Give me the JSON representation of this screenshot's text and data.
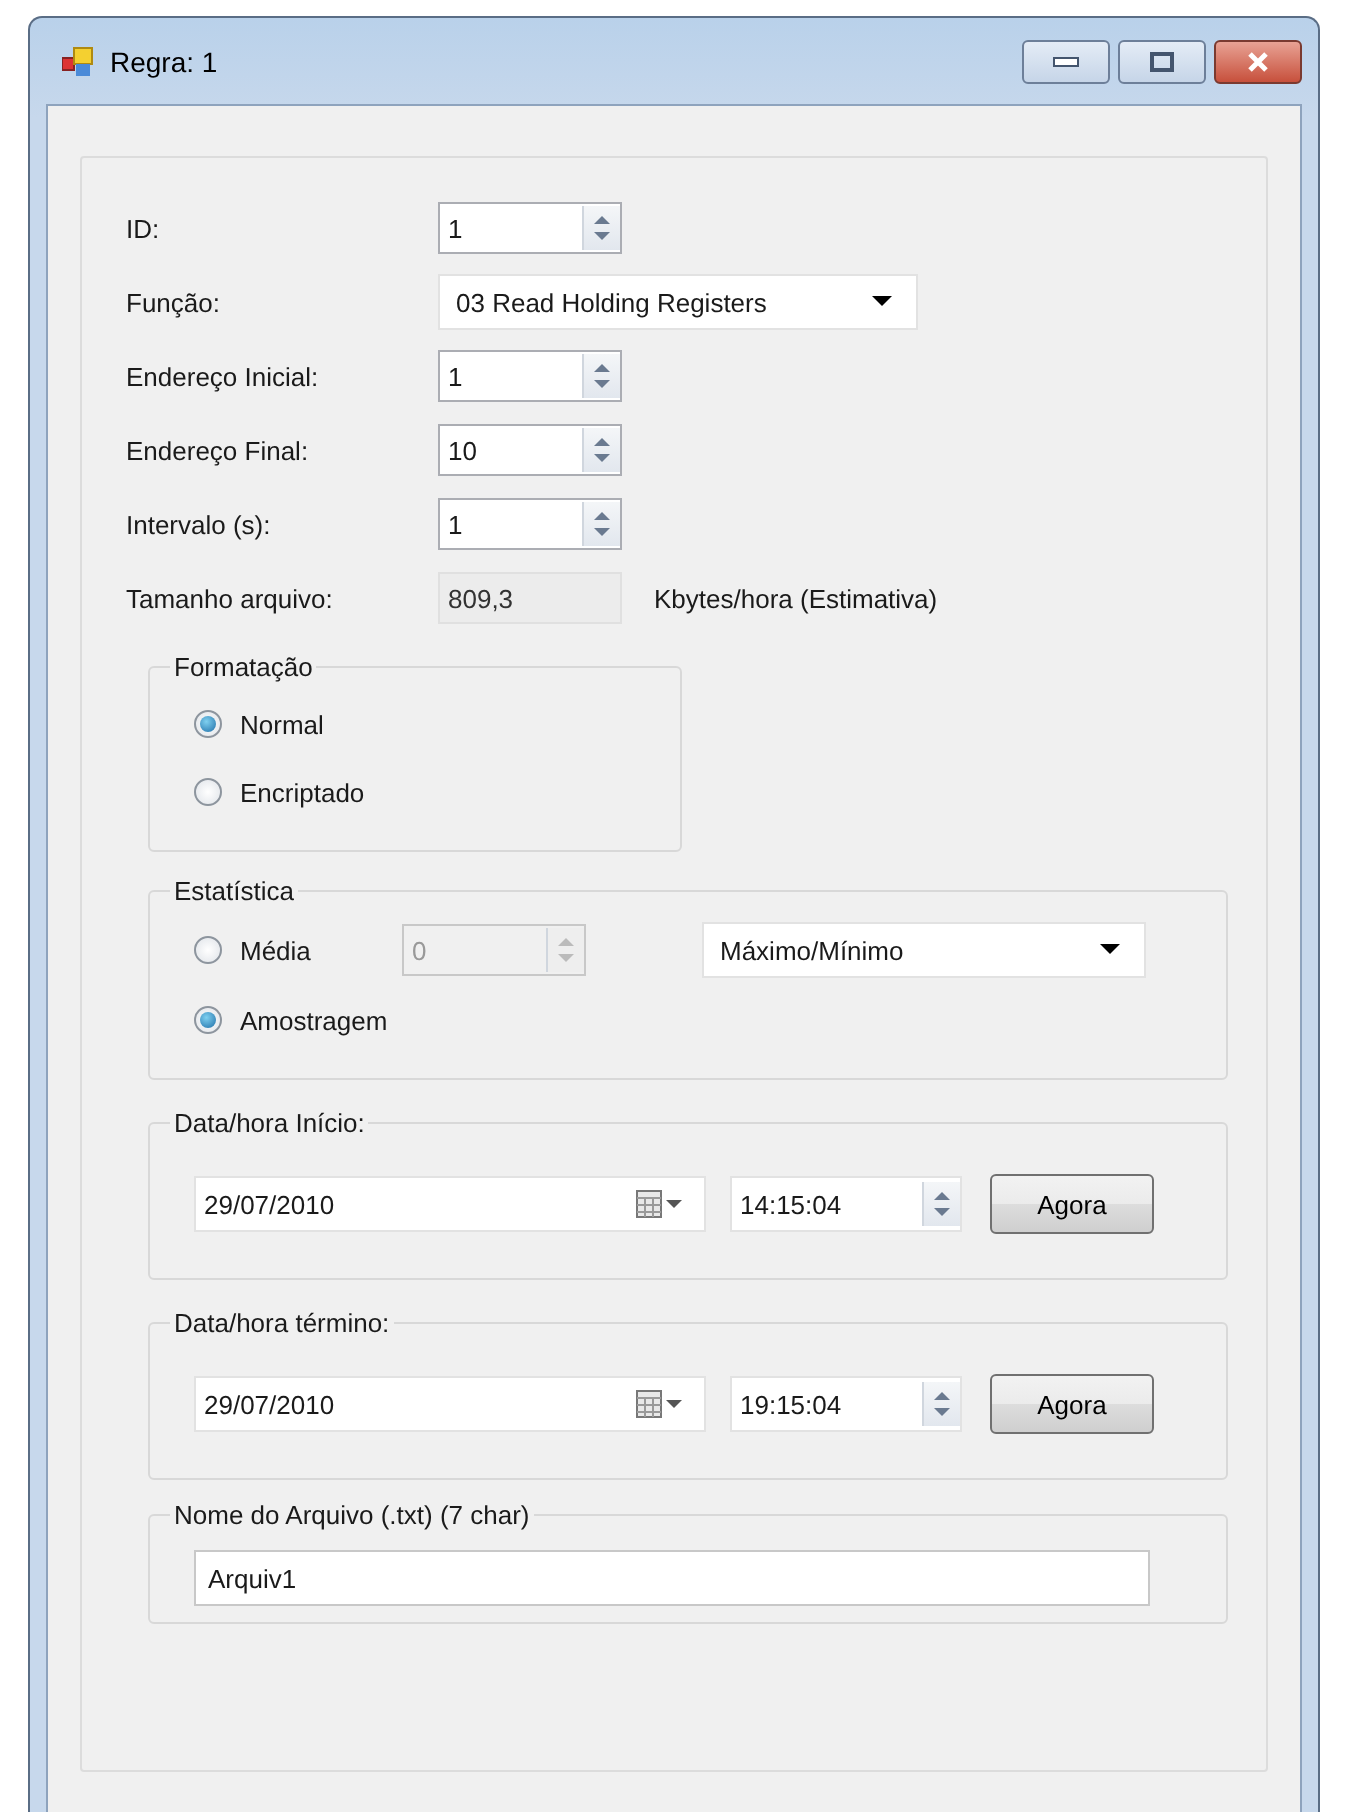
{
  "window": {
    "title": "Regra: 1"
  },
  "fields": [
    {
      "label": "ID:",
      "kind": "spinner",
      "value": "1"
    },
    {
      "label": "Função:",
      "kind": "dropdown",
      "value": "03 Read Holding Registers"
    },
    {
      "label": "Endereço Inicial:",
      "kind": "spinner",
      "value": "1"
    },
    {
      "label": "Endereço Final:",
      "kind": "spinner",
      "value": "10"
    },
    {
      "label": "Intervalo (s):",
      "kind": "spinner",
      "value": "1"
    },
    {
      "label": "Tamanho arquivo:",
      "kind": "readonly",
      "value": "809,3",
      "unit": "Kbytes/hora (Estimativa)"
    }
  ],
  "formatacao": {
    "title": "Formatação",
    "options": [
      {
        "label": "Normal",
        "selected": true
      },
      {
        "label": "Encriptado",
        "selected": false
      }
    ]
  },
  "estatistica": {
    "title": "Estatística",
    "options": [
      {
        "label": "Média",
        "selected": false
      },
      {
        "label": "Amostragem",
        "selected": true
      }
    ],
    "media_spinner": {
      "value": "0",
      "disabled": true
    },
    "mode": {
      "value": "Máximo/Mínimo"
    }
  },
  "periods": [
    {
      "title": "Data/hora Início:",
      "date": "29/07/2010",
      "time": "14:15:04",
      "button": "Agora"
    },
    {
      "title": "Data/hora término:",
      "date": "29/07/2010",
      "time": "19:15:04",
      "button": "Agora"
    }
  ],
  "arquivo": {
    "title": "Nome do Arquivo (.txt) (7 char)",
    "value": "Arquiv1"
  }
}
